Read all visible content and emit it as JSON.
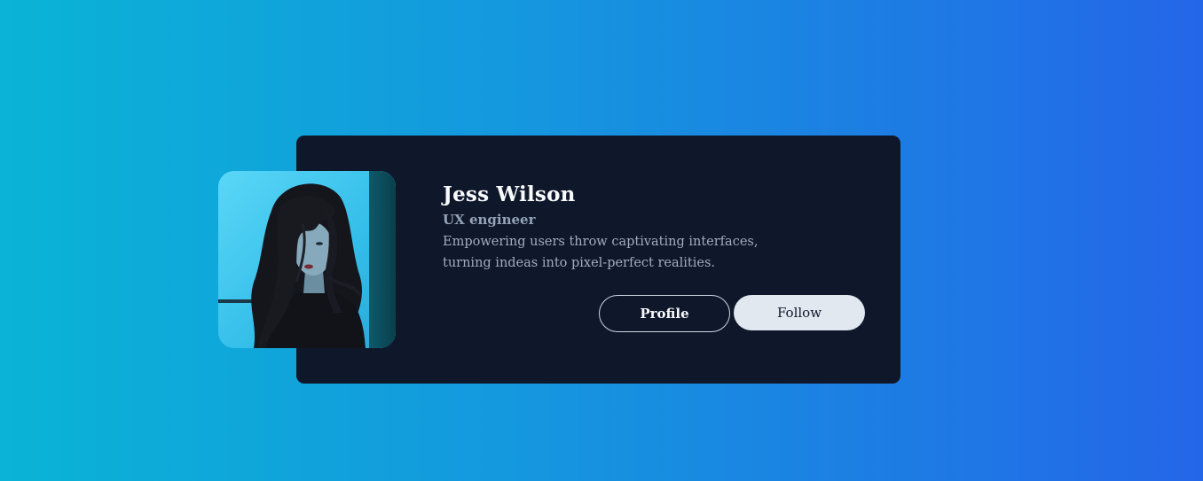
{
  "profile": {
    "name": "Jess Wilson",
    "role": "UX engineer",
    "bio": "Empowering users throw captivating interfaces, turning indeas into pixel-perfect realities."
  },
  "actions": {
    "profile_label": "Profile",
    "follow_label": "Follow"
  },
  "colors": {
    "background_start": "#0ab4d6",
    "background_end": "#2466e8",
    "card": "#0f172a",
    "follow_button": "#e2e8f0"
  },
  "avatar": {
    "icon": "profile-photo"
  }
}
